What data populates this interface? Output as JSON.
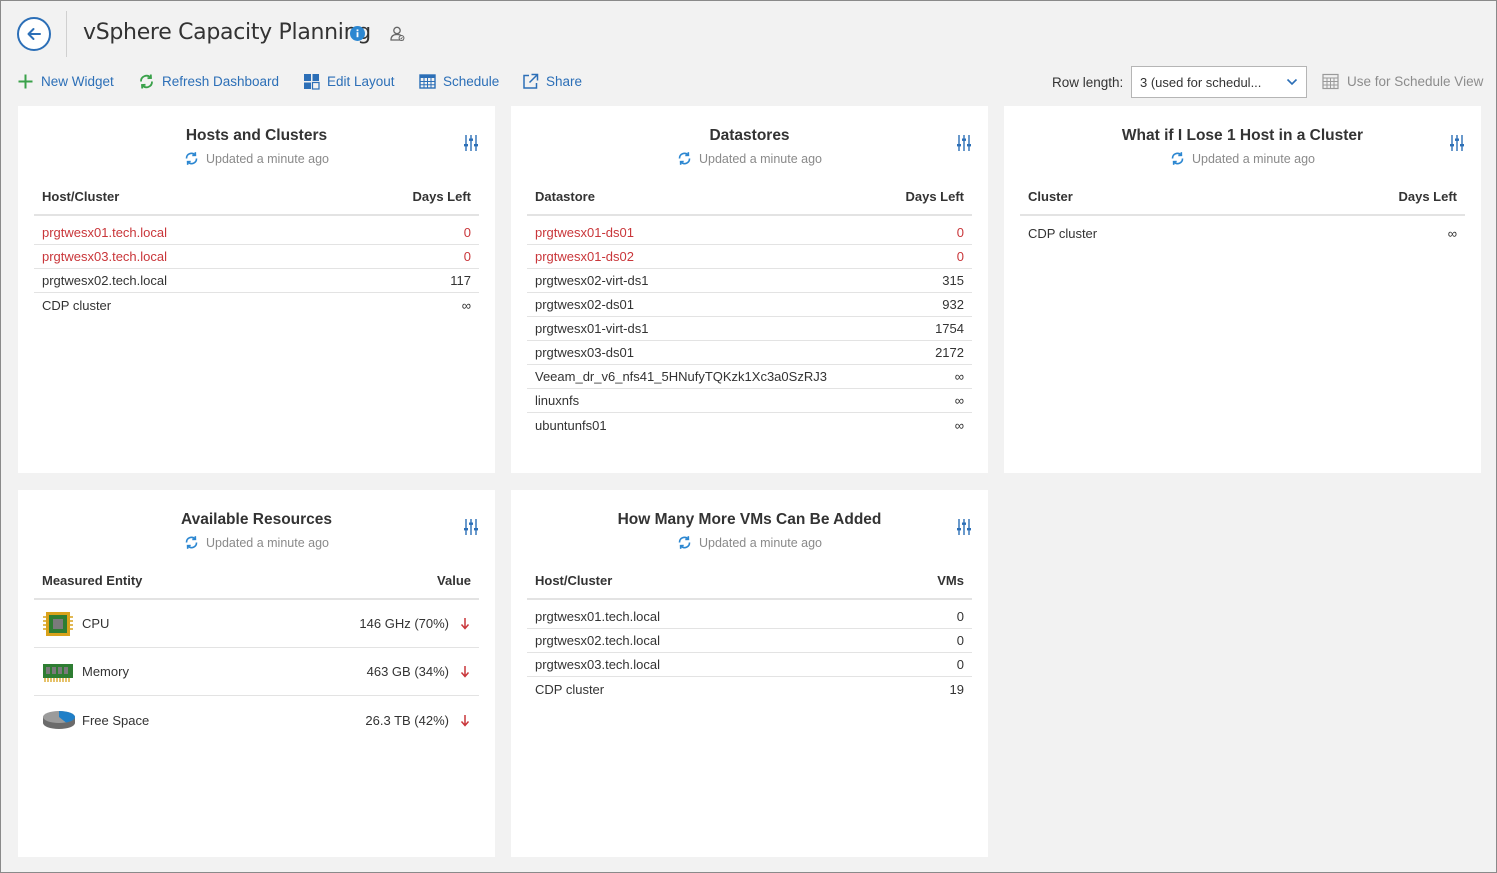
{
  "header": {
    "title": "vSphere Capacity Planning"
  },
  "toolbar": {
    "new_widget": "New Widget",
    "refresh_dashboard": "Refresh Dashboard",
    "edit_layout": "Edit Layout",
    "schedule": "Schedule",
    "share": "Share",
    "row_length_label": "Row length:",
    "row_length_value": "3 (used for schedul...",
    "use_for_schedule_view": "Use for Schedule View"
  },
  "colors": {
    "accent": "#2c6fb7",
    "alert": "#c9363a",
    "refresh_green": "#3aa14a"
  },
  "widgets": {
    "hosts_clusters": {
      "title": "Hosts and Clusters",
      "updated": "Updated a minute ago",
      "col1": "Host/Cluster",
      "col2": "Days Left",
      "rows": [
        {
          "name": "prgtwesx01.tech.local",
          "value": "0",
          "alert": true
        },
        {
          "name": "prgtwesx03.tech.local",
          "value": "0",
          "alert": true
        },
        {
          "name": "prgtwesx02.tech.local",
          "value": "117",
          "alert": false
        },
        {
          "name": "CDP cluster",
          "value": "∞",
          "alert": false
        }
      ]
    },
    "datastores": {
      "title": "Datastores",
      "updated": "Updated a minute ago",
      "col1": "Datastore",
      "col2": "Days Left",
      "rows": [
        {
          "name": "prgtwesx01-ds01",
          "value": "0",
          "alert": true
        },
        {
          "name": "prgtwesx01-ds02",
          "value": "0",
          "alert": true
        },
        {
          "name": "prgtwesx02-virt-ds1",
          "value": "315",
          "alert": false
        },
        {
          "name": "prgtwesx02-ds01",
          "value": "932",
          "alert": false
        },
        {
          "name": "prgtwesx01-virt-ds1",
          "value": "1754",
          "alert": false
        },
        {
          "name": "prgtwesx03-ds01",
          "value": "2172",
          "alert": false
        },
        {
          "name": "Veeam_dr_v6_nfs41_5HNufyTQKzk1Xc3a0SzRJ3",
          "value": "∞",
          "alert": false
        },
        {
          "name": "linuxnfs",
          "value": "∞",
          "alert": false
        },
        {
          "name": "ubuntunfs01",
          "value": "∞",
          "alert": false
        }
      ]
    },
    "lose_host": {
      "title": "What if I Lose 1 Host in a Cluster",
      "updated": "Updated a minute ago",
      "col1": "Cluster",
      "col2": "Days Left",
      "rows": [
        {
          "name": "CDP cluster",
          "value": "∞",
          "alert": false
        }
      ]
    },
    "available_resources": {
      "title": "Available Resources",
      "updated": "Updated a minute ago",
      "col1": "Measured Entity",
      "col2": "Value",
      "rows": [
        {
          "name": "CPU",
          "value": "146 GHz (70%)",
          "icon": "cpu-icon"
        },
        {
          "name": "Memory",
          "value": "463 GB (34%)",
          "icon": "memory-icon"
        },
        {
          "name": "Free Space",
          "value": "26.3 TB (42%)",
          "icon": "disk-icon"
        }
      ]
    },
    "vms_added": {
      "title": "How Many More VMs Can Be Added",
      "updated": "Updated a minute ago",
      "col1": "Host/Cluster",
      "col2": "VMs",
      "rows": [
        {
          "name": "prgtwesx01.tech.local",
          "value": "0",
          "alert": false
        },
        {
          "name": "prgtwesx02.tech.local",
          "value": "0",
          "alert": false
        },
        {
          "name": "prgtwesx03.tech.local",
          "value": "0",
          "alert": false
        },
        {
          "name": "CDP cluster",
          "value": "19",
          "alert": false
        }
      ]
    }
  }
}
